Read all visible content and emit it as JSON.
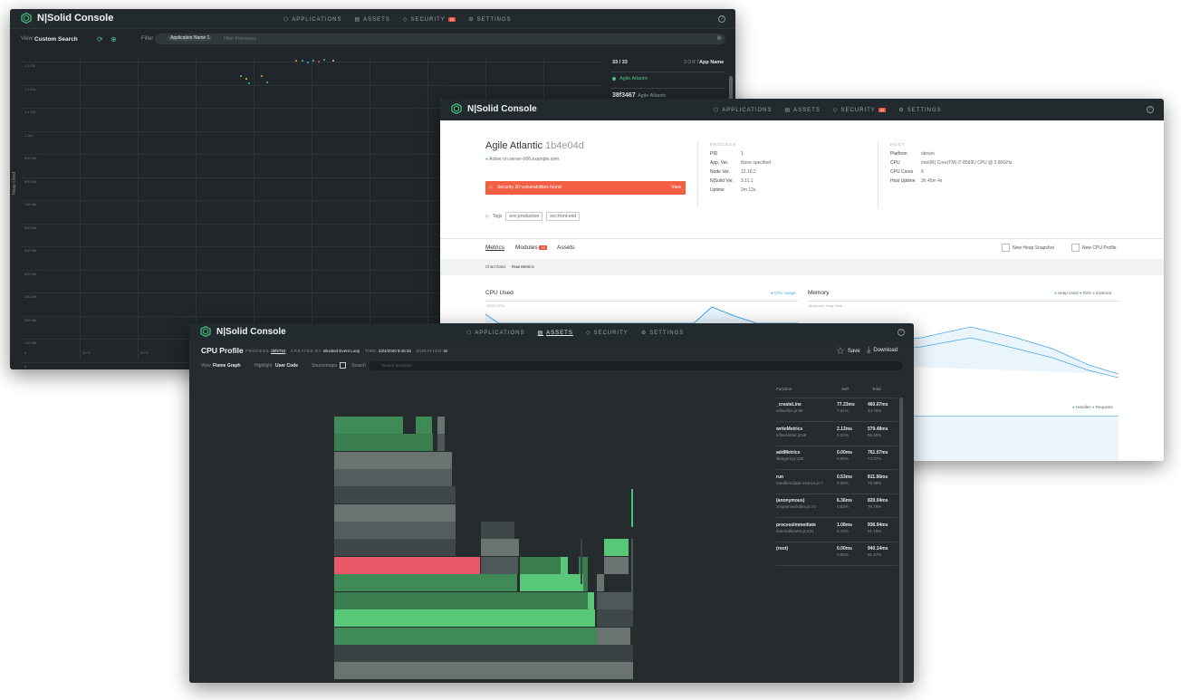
{
  "nav": {
    "applications": "APPLICATIONS",
    "assets": "ASSETS",
    "security": "SECURITY",
    "security_badge": "20",
    "settings": "SETTINGS"
  },
  "brand": "N|Solid Console",
  "scatter_window": {
    "view_label": "View",
    "view_value": "Custom Search",
    "filter_label": "Filter",
    "filter_chip": "Application Name",
    "filter_chip_count": "1",
    "filter_placeholder": "Filter Processes",
    "y_axis_title": "Heap Used",
    "y_ticks": [
      "1.5 Gb",
      "1.2 Gb",
      "1.1 Gb",
      "1 Gb",
      "900 Mb",
      "800 Mb",
      "700 Mb",
      "600 Mb",
      "500 Mb",
      "400 Mb",
      "300 Mb",
      "200 Mb",
      "100 Mb",
      "0"
    ],
    "x_ticks": [
      "0",
      "10 %",
      "20 %"
    ],
    "count": "33 / 33",
    "sort_label": "SORT",
    "sort_value": "App Name",
    "list": [
      {
        "name": "Agile Atlantic",
        "id": ""
      },
      {
        "name": "Agile Atlantic",
        "id": "38f3467"
      }
    ]
  },
  "process_window": {
    "app_name": "Agile Atlantic",
    "process_id": "1b4e04d",
    "status": "Active on server-006.example.com",
    "security_banner": "Security 20 vulnerabilities found",
    "security_view": "View",
    "tags_label": "Tags",
    "tags": [
      "env:production",
      "svc:front-end"
    ],
    "process_heading": "PROCESS",
    "process_info": [
      {
        "k": "PID",
        "v": "1"
      },
      {
        "k": "App. Ver.",
        "v": "None specified"
      },
      {
        "k": "Node Ver.",
        "v": "12.16.2"
      },
      {
        "k": "N|Solid Ver.",
        "v": "3.11.1"
      },
      {
        "k": "Uptime",
        "v": "2m 12s"
      }
    ],
    "host_heading": "HOST",
    "host_info": [
      {
        "k": "Platform",
        "v": "darwin"
      },
      {
        "k": "CPU",
        "v": "Intel(R) Core(TM) i7-8569U CPU @ 2.80GHz"
      },
      {
        "k": "CPU Cores",
        "v": "8"
      },
      {
        "k": "Host Uptime",
        "v": "3h 45m 4s"
      }
    ],
    "tabs": {
      "metrics": "Metrics",
      "modules": "Modules",
      "modules_badge": "20",
      "assets": "Assets"
    },
    "heap_snapshot": "New Heap Snapshot",
    "cpu_profile": "New CPU Profile",
    "chart_data_label": "Chart Data:",
    "chart_data_value": "Raw Metrics",
    "cpu_chart": {
      "title": "CPU Used",
      "legend": "CPU Usage",
      "top_label": "100% CPU"
    },
    "memory_chart": {
      "title": "Memory",
      "legends": [
        "Heap Used",
        "RSS",
        "External"
      ],
      "top_label": "Maximum Heap Size"
    },
    "handles_legends": [
      "Handles",
      "Requests"
    ],
    "colors": {
      "accent": "#4aa8e8",
      "danger": "#f25f43"
    }
  },
  "profile_window": {
    "title": "CPU Profile",
    "process_label": "PROCESS",
    "process_value": "d8f9783",
    "created_label": "CREATED BY",
    "created_value": "Blocked Event Loop",
    "time_label": "TIME",
    "time_value": "23/4/2020 8:45:32",
    "duration_label": "DURATION",
    "duration_value": "3s",
    "save": "Save",
    "download": "Download",
    "view_label": "View",
    "view_value": "Flame Graph",
    "highlight_label": "Highlight",
    "highlight_value": "User Code",
    "sourcemaps_label": "Sourcemaps",
    "search_label": "Search",
    "search_placeholder": "Search functions",
    "columns": {
      "function": "Function",
      "self": "Self",
      "total": "Total"
    },
    "rows": [
      {
        "fn": "_createLine",
        "path": "influx/line.js:96",
        "self": "77.23ms",
        "self_pct": "7.61%",
        "total": "460.07ms",
        "total_pct": "44.76%"
      },
      {
        "fn": "writeMetrics",
        "path": "influx/writer.js:66",
        "self": "2.12ms",
        "self_pct": "0.21%",
        "total": "579.48ms",
        "total_pct": "56.40%"
      },
      {
        "fn": "addMetrics",
        "path": "lib/agent.js:130",
        "self": "0.00ms",
        "self_pct": "0.00%",
        "total": "761.07ms",
        "total_pct": "74.07%"
      },
      {
        "fn": "run",
        "path": "handlers/data-metrics.js:7",
        "self": "0.53ms",
        "self_pct": "0.05%",
        "total": "811.56ms",
        "total_pct": "78.98%"
      },
      {
        "fn": "(anonymous)",
        "path": "zmqserver/index.js:74",
        "self": "6.36ms",
        "self_pct": "0.62%",
        "total": "820.04ms",
        "total_pct": "79.78%"
      },
      {
        "fn": "processImmediate",
        "path": "internal/timers.js:431",
        "self": "1.08ms",
        "self_pct": "0.10%",
        "total": "936.94ms",
        "total_pct": "91.19%"
      },
      {
        "fn": "(root)",
        "path": "-",
        "self": "0.00ms",
        "self_pct": "0.00%",
        "total": "940.14ms",
        "total_pct": "91.47%"
      }
    ]
  }
}
